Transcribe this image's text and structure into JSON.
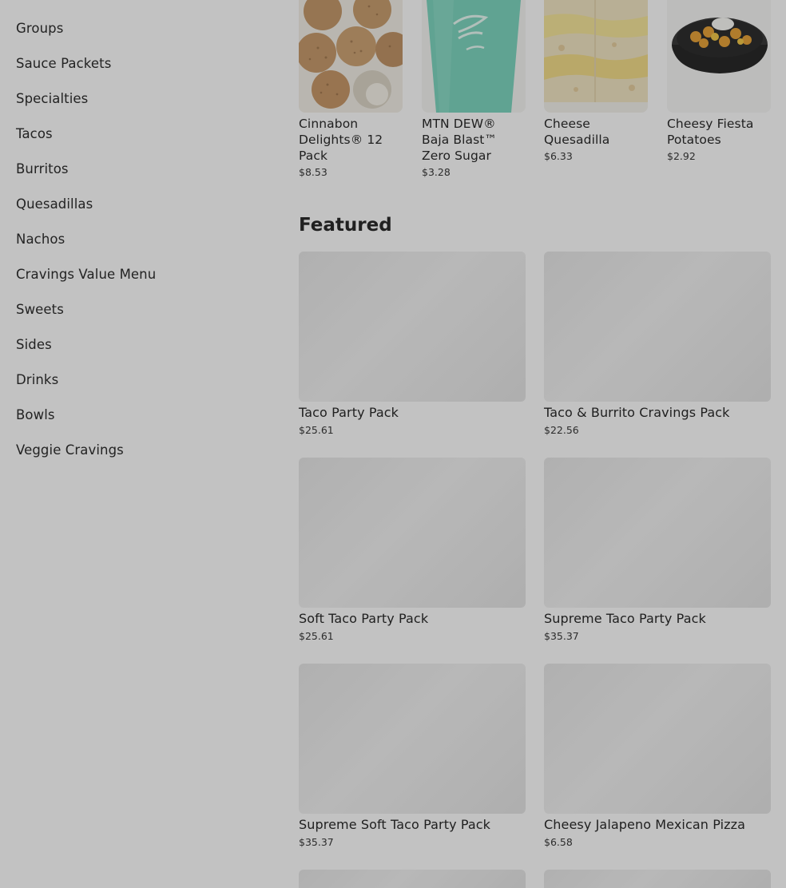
{
  "sidebar": {
    "items": [
      {
        "label": "Groups"
      },
      {
        "label": "Sauce Packets"
      },
      {
        "label": "Specialties"
      },
      {
        "label": "Tacos"
      },
      {
        "label": "Burritos"
      },
      {
        "label": "Quesadillas"
      },
      {
        "label": "Nachos"
      },
      {
        "label": "Cravings Value Menu"
      },
      {
        "label": "Sweets"
      },
      {
        "label": "Sides"
      },
      {
        "label": "Drinks"
      },
      {
        "label": "Bowls"
      },
      {
        "label": "Veggie Cravings"
      }
    ]
  },
  "top_products": [
    {
      "name": "Cinnabon Delights® 12 Pack",
      "price": "$8.53",
      "image": "cinnabon-delights-image"
    },
    {
      "name": "MTN DEW® Baja Blast™ Zero Sugar",
      "price": "$3.28",
      "image": "baja-blast-cup-image"
    },
    {
      "name": "Cheese Quesadilla",
      "price": "$6.33",
      "image": "cheese-quesadilla-image"
    },
    {
      "name": "Cheesy Fiesta Potatoes",
      "price": "$2.92",
      "image": "fiesta-potatoes-image"
    }
  ],
  "featured": {
    "title": "Featured",
    "items": [
      {
        "name": "Taco Party Pack",
        "price": "$25.61"
      },
      {
        "name": "Taco & Burrito Cravings Pack",
        "price": "$22.56"
      },
      {
        "name": "Soft Taco Party Pack",
        "price": "$25.61"
      },
      {
        "name": "Supreme Taco Party Pack",
        "price": "$35.37"
      },
      {
        "name": "Supreme Soft Taco Party Pack",
        "price": "$35.37"
      },
      {
        "name": "Cheesy Jalapeno Mexican Pizza",
        "price": "$6.58"
      }
    ]
  },
  "colors": {
    "overlay": "rgba(0,0,0,0.24)",
    "text": "#2b2b2b",
    "placeholder": "#eeeeee"
  }
}
